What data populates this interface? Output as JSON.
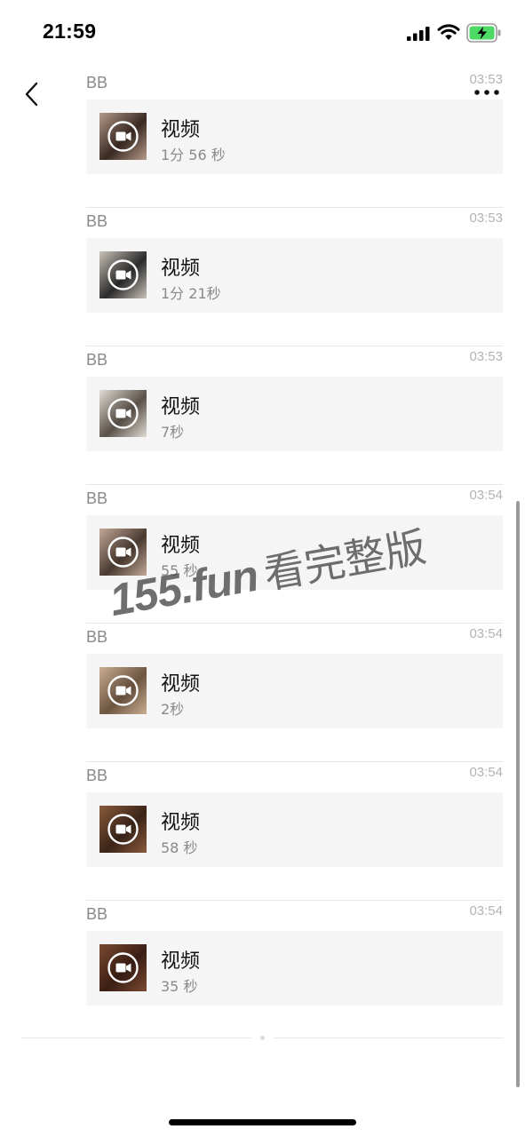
{
  "status_bar": {
    "time": "21:59"
  },
  "messages": [
    {
      "sender": "BB",
      "time": "03:53",
      "title": "视频",
      "duration": "1分 56 秒",
      "thumb_colors": [
        "#3a2a22",
        "#b59a8a"
      ]
    },
    {
      "sender": "BB",
      "time": "03:53",
      "title": "视频",
      "duration": "1分 21秒",
      "thumb_colors": [
        "#2b2b2b",
        "#c9c2b8"
      ]
    },
    {
      "sender": "BB",
      "time": "03:53",
      "title": "视频",
      "duration": "7秒",
      "thumb_colors": [
        "#5a5148",
        "#e0dcd5"
      ]
    },
    {
      "sender": "BB",
      "time": "03:54",
      "title": "视频",
      "duration": "55 秒",
      "thumb_colors": [
        "#4a3a30",
        "#c2a898"
      ]
    },
    {
      "sender": "BB",
      "time": "03:54",
      "title": "视频",
      "duration": "2秒",
      "thumb_colors": [
        "#6d5540",
        "#c9ad92"
      ]
    },
    {
      "sender": "BB",
      "time": "03:54",
      "title": "视频",
      "duration": "58 秒",
      "thumb_colors": [
        "#3b2418",
        "#8a5a3c"
      ]
    },
    {
      "sender": "BB",
      "time": "03:54",
      "title": "视频",
      "duration": "35 秒",
      "thumb_colors": [
        "#3a1e14",
        "#7a4a30"
      ]
    }
  ],
  "watermark": {
    "domain": "155.fun",
    "text": "看完整版"
  },
  "icons": {
    "back": "chevron-left-icon",
    "more": "more-dots-icon",
    "play": "video-camera-icon",
    "signal": "signal-icon",
    "wifi": "wifi-icon",
    "battery": "battery-charging-icon"
  },
  "colors": {
    "card_bg": "#f5f5f5",
    "battery_fill": "#4cd964",
    "secondary_text": "#8a8a8a"
  }
}
